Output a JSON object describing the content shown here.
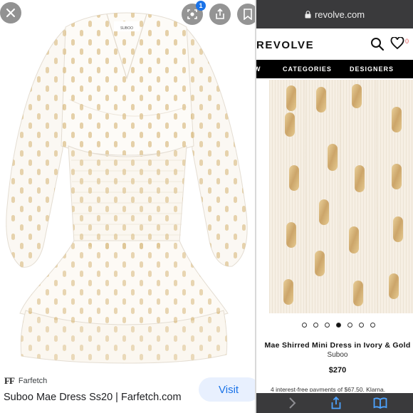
{
  "left_panel": {
    "badge_count": "1",
    "thumbnail_label": "SUBOO",
    "source": {
      "logo_text": "FF",
      "name": "Farfetch"
    },
    "result_title": "Suboo Mae Dress Ss20 | Farfetch.com",
    "visit_label": "Visit",
    "icons": [
      "close-icon",
      "lens-icon",
      "share-icon",
      "bookmark-icon"
    ]
  },
  "right_panel": {
    "url": "revolve.com",
    "logo": "REVOLVE",
    "wishlist_count": "0",
    "nav": [
      "W",
      "CATEGORIES",
      "DESIGNERS"
    ],
    "carousel": {
      "count": 7,
      "active_index": 3
    },
    "product": {
      "name": "Mae Shirred Mini Dress in Ivory & Gold",
      "brand": "Suboo",
      "price": "$270",
      "installment_text": "4 interest-free payments of $67.50. Klarna."
    },
    "toolbar_icons": [
      "forward-icon",
      "share-icon",
      "bookmarks-icon"
    ]
  },
  "colors": {
    "fabric": "#f6efe4",
    "gold": "#d9b77a",
    "nav_bg": "#000000",
    "browser_chrome": "#3a3a3c",
    "visit_bg": "#e8f0fe",
    "visit_text": "#1a73e8"
  }
}
